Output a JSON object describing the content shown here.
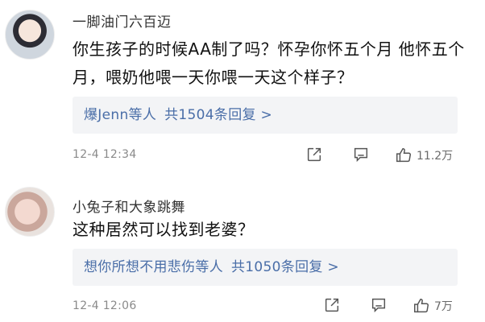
{
  "comments": [
    {
      "username": "一脚油门六百迈",
      "text": "你生孩子的时候AA制了吗？怀孕你怀五个月 他怀五个月，喂奶他喂一天你喂一天这个样子？",
      "replies": {
        "names": "爆Jenn等人",
        "count_text": "共1504条回复 >"
      },
      "timestamp": "12-4  12:34",
      "likes": "11.2万",
      "icons": {
        "share": "share-icon",
        "comment": "comment-icon",
        "like": "thumbs-up-icon"
      }
    },
    {
      "username": "小兔子和大象跳舞",
      "text": "这种居然可以找到老婆？",
      "replies": {
        "names": "想你所想不用悲伤等人",
        "count_text": "共1050条回复 >"
      },
      "timestamp": "12-4  12:06",
      "likes": "7万",
      "icons": {
        "share": "share-icon",
        "comment": "comment-icon",
        "like": "thumbs-up-icon"
      }
    }
  ],
  "colors": {
    "link": "#4a6ea8",
    "reply_bg": "#f3f4f6",
    "meta": "#8a8a8a"
  }
}
